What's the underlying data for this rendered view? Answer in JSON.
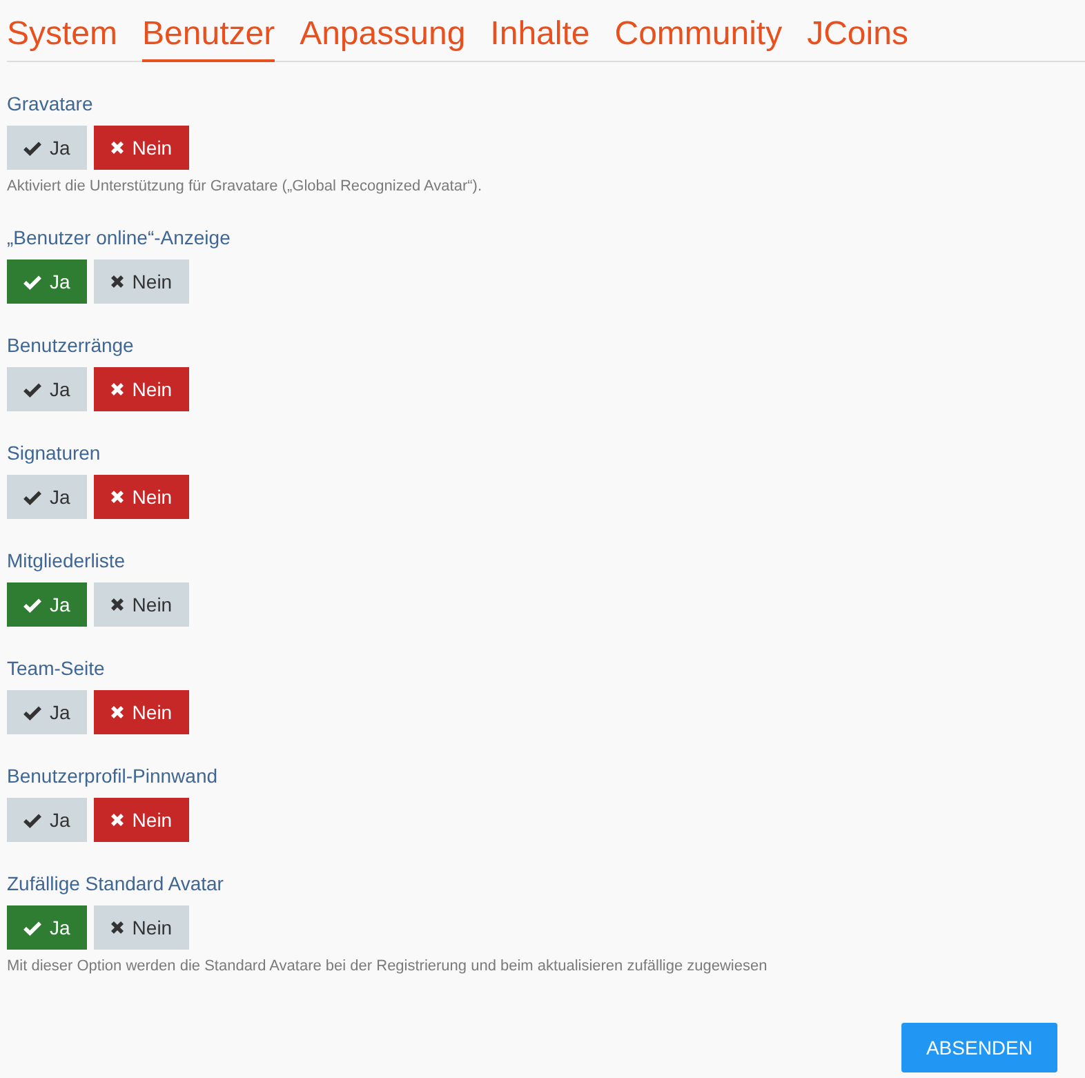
{
  "tabs": [
    {
      "label": "System",
      "selected": false
    },
    {
      "label": "Benutzer",
      "selected": true
    },
    {
      "label": "Anpassung",
      "selected": false
    },
    {
      "label": "Inhalte",
      "selected": false
    },
    {
      "label": "Community",
      "selected": false
    },
    {
      "label": "JCoins",
      "selected": false
    }
  ],
  "settings": [
    {
      "label": "Gravatare",
      "options": [
        {
          "kind": "yes",
          "label": "Ja",
          "selected": false
        },
        {
          "kind": "no",
          "label": "Nein",
          "selected": true
        }
      ],
      "help": "Aktiviert die Unterstützung für Gravatare („Global Recognized Avatar“)."
    },
    {
      "label": "„Benutzer online“-Anzeige",
      "options": [
        {
          "kind": "yes",
          "label": "Ja",
          "selected": true
        },
        {
          "kind": "no",
          "label": "Nein",
          "selected": false
        }
      ]
    },
    {
      "label": "Benutzerränge",
      "options": [
        {
          "kind": "yes",
          "label": "Ja",
          "selected": false
        },
        {
          "kind": "no",
          "label": "Nein",
          "selected": true
        }
      ]
    },
    {
      "label": "Signaturen",
      "options": [
        {
          "kind": "yes",
          "label": "Ja",
          "selected": false
        },
        {
          "kind": "no",
          "label": "Nein",
          "selected": true
        }
      ]
    },
    {
      "label": "Mitgliederliste",
      "options": [
        {
          "kind": "yes",
          "label": "Ja",
          "selected": true
        },
        {
          "kind": "no",
          "label": "Nein",
          "selected": false
        }
      ]
    },
    {
      "label": "Team-Seite",
      "options": [
        {
          "kind": "yes",
          "label": "Ja",
          "selected": false
        },
        {
          "kind": "no",
          "label": "Nein",
          "selected": true
        }
      ]
    },
    {
      "label": "Benutzerprofil-Pinnwand",
      "options": [
        {
          "kind": "yes",
          "label": "Ja",
          "selected": false
        },
        {
          "kind": "no",
          "label": "Nein",
          "selected": true
        }
      ]
    },
    {
      "label": "Zufällige Standard Avatar",
      "options": [
        {
          "kind": "yes",
          "label": "Ja",
          "selected": true
        },
        {
          "kind": "no",
          "label": "Nein",
          "selected": false
        }
      ],
      "help": "Mit dieser Option werden die Standard Avatare bei der Registrierung und beim aktualisieren zufällige zugewiesen"
    }
  ],
  "submit": "ABSENDEN"
}
